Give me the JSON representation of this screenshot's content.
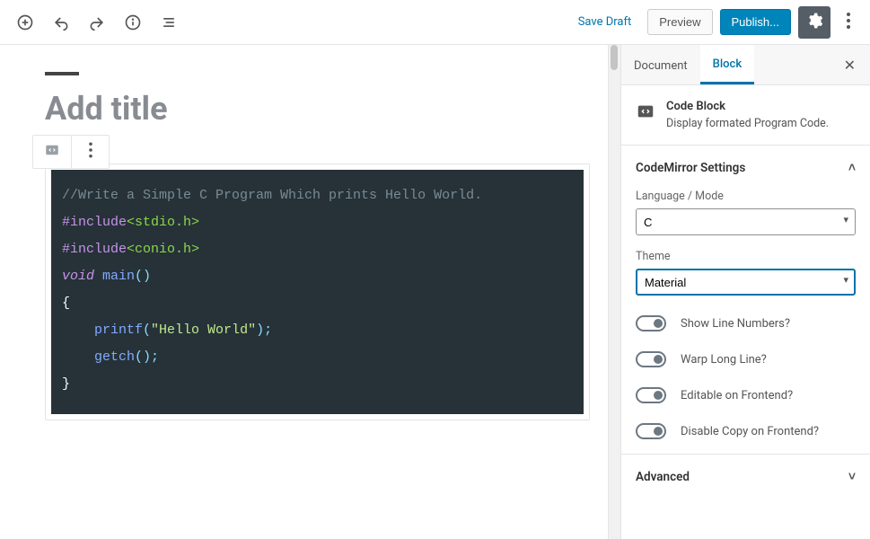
{
  "toolbar": {
    "save_draft": "Save Draft",
    "preview": "Preview",
    "publish": "Publish..."
  },
  "editor": {
    "title_placeholder": "Add title",
    "code_lines": {
      "l1": "//Write a Simple C Program Which prints Hello World.",
      "l2_meta": "#include",
      "l2_path": "<stdio.h>",
      "l3_meta": "#include",
      "l3_path": "<conio.h>",
      "l4_kw": "void",
      "l4_fn": " main",
      "l4_paren": "()",
      "l5": "{",
      "l6_indent": "    ",
      "l6_fn": "printf",
      "l6_open": "(",
      "l6_str": "\"Hello World\"",
      "l6_close": ");",
      "l7_indent": "    ",
      "l7_fn": "getch",
      "l7_rest": "();",
      "l8": "}"
    }
  },
  "sidebar": {
    "tabs": {
      "document": "Document",
      "block": "Block"
    },
    "block_info": {
      "name": "Code Block",
      "desc": "Display formated Program Code."
    },
    "settings_title": "CodeMirror Settings",
    "language_label": "Language / Mode",
    "language_value": "C",
    "theme_label": "Theme",
    "theme_value": "Material",
    "toggles": {
      "line_numbers": "Show Line Numbers?",
      "wrap": "Warp Long Line?",
      "editable": "Editable on Frontend?",
      "disable_copy": "Disable Copy on Frontend?"
    },
    "advanced_title": "Advanced"
  }
}
